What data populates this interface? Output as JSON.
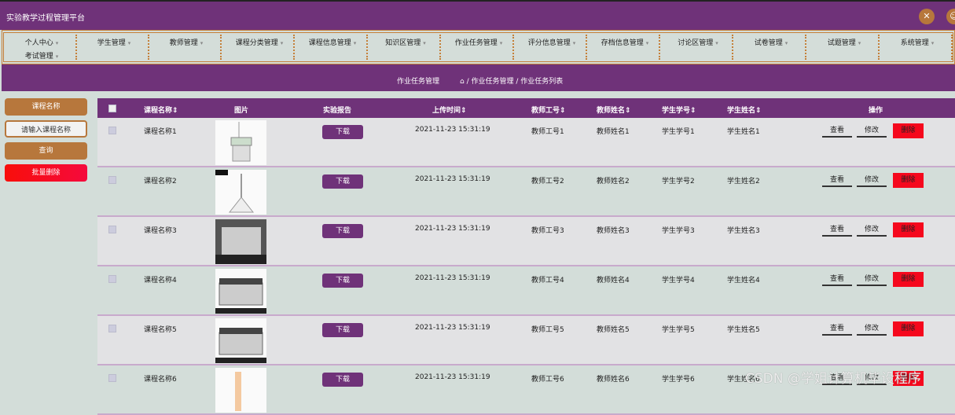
{
  "app_title": "实验教学过程管理平台",
  "nav": [
    "个人中心",
    "学生管理",
    "教师管理",
    "课程分类管理",
    "课程信息管理",
    "知识区管理",
    "作业任务管理",
    "评分信息管理",
    "存档信息管理",
    "讨论区管理",
    "试卷管理",
    "试题管理",
    "系统管理",
    "考试管理"
  ],
  "breadcrumb": {
    "page": "作业任务管理",
    "path1": "作业任务管理",
    "path2": "作业任务列表"
  },
  "sidebar": {
    "label": "课程名称",
    "placeholder": "请输入课程名称",
    "search": "查询",
    "batch_delete": "批量删除"
  },
  "table": {
    "headers": {
      "name": "课程名称",
      "image": "图片",
      "report": "实验报告",
      "time": "上传时间",
      "tid": "教师工号",
      "tname": "教师姓名",
      "sid": "学生学号",
      "sname": "学生姓名",
      "ops": "操作"
    },
    "sort_icon": "⇕",
    "download": "下载",
    "view": "查看",
    "edit": "修改",
    "delete": "删除",
    "rows": [
      {
        "name": "课程名称1",
        "time": "2021-11-23 15:31:19",
        "tid": "教师工号1",
        "tname": "教师姓名1",
        "sid": "学生学号1",
        "sname": "学生姓名1"
      },
      {
        "name": "课程名称2",
        "time": "2021-11-23 15:31:19",
        "tid": "教师工号2",
        "tname": "教师姓名2",
        "sid": "学生学号2",
        "sname": "学生姓名2"
      },
      {
        "name": "课程名称3",
        "time": "2021-11-23 15:31:19",
        "tid": "教师工号3",
        "tname": "教师姓名3",
        "sid": "学生学号3",
        "sname": "学生姓名3"
      },
      {
        "name": "课程名称4",
        "time": "2021-11-23 15:31:19",
        "tid": "教师工号4",
        "tname": "教师姓名4",
        "sid": "学生学号4",
        "sname": "学生姓名4"
      },
      {
        "name": "课程名称5",
        "time": "2021-11-23 15:31:19",
        "tid": "教师工号5",
        "tname": "教师姓名5",
        "sid": "学生学号5",
        "sname": "学生姓名5"
      },
      {
        "name": "课程名称6",
        "time": "2021-11-23 15:31:19",
        "tid": "教师工号6",
        "tname": "教师姓名6",
        "sid": "学生学号6",
        "sname": "学生姓名6"
      }
    ]
  },
  "watermark": "CSDN @学姐计算机毕设程序"
}
